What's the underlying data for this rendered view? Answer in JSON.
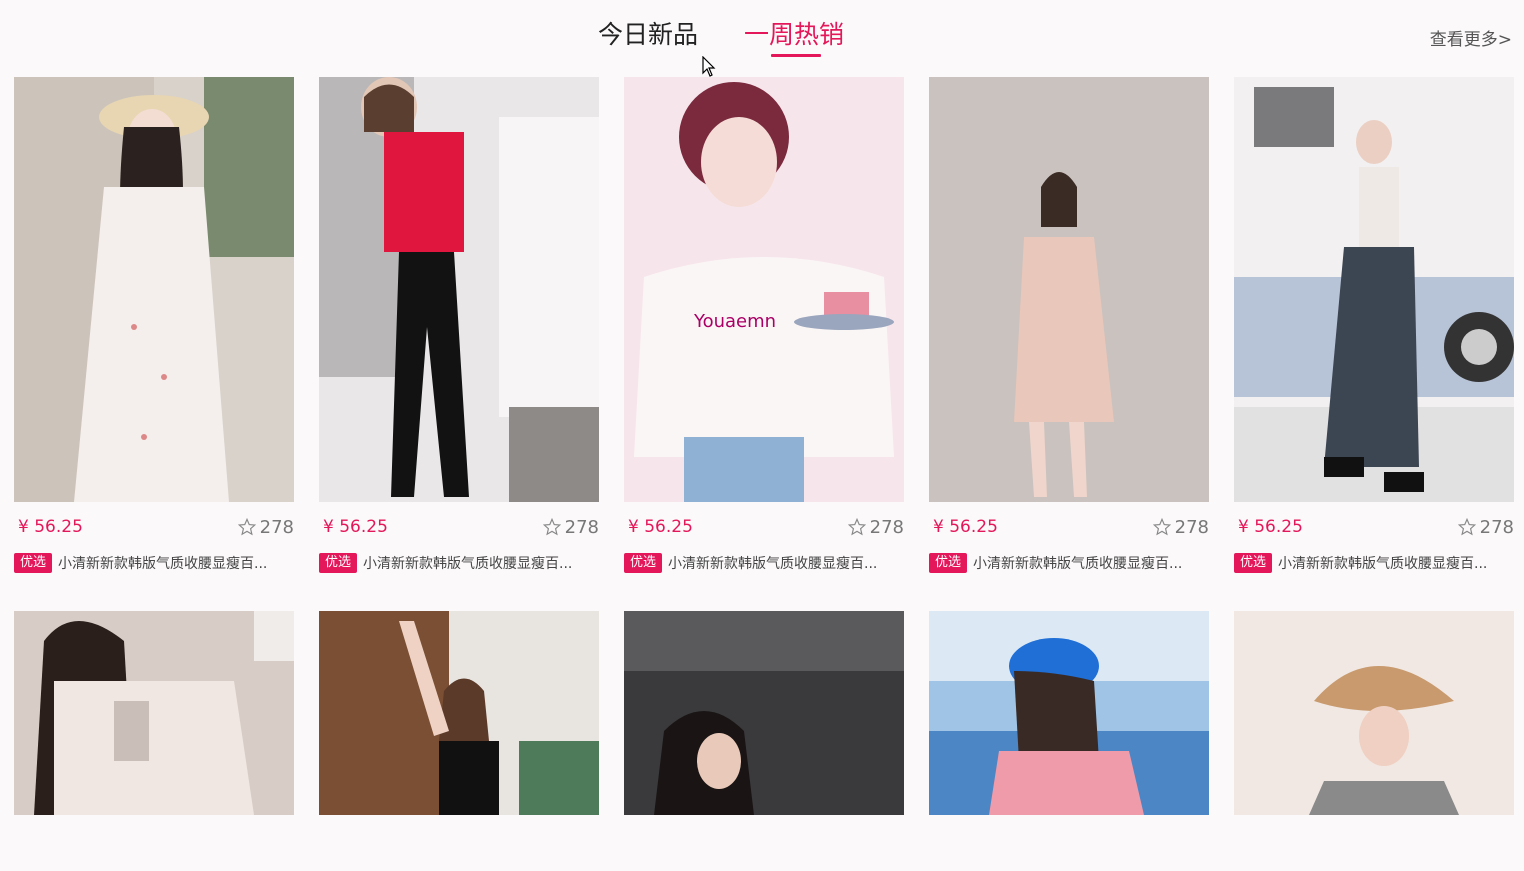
{
  "tabs": {
    "new_label": "今日新品",
    "hot_label": "一周热销"
  },
  "more_label": "查看更多>",
  "products": [
    {
      "price": "¥ 56.25",
      "fav_count": "278",
      "badge": "优选",
      "title": "小清新新款韩版气质收腰显瘦百..."
    },
    {
      "price": "¥ 56.25",
      "fav_count": "278",
      "badge": "优选",
      "title": "小清新新款韩版气质收腰显瘦百..."
    },
    {
      "price": "¥ 56.25",
      "fav_count": "278",
      "badge": "优选",
      "title": "小清新新款韩版气质收腰显瘦百..."
    },
    {
      "price": "¥ 56.25",
      "fav_count": "278",
      "badge": "优选",
      "title": "小清新新款韩版气质收腰显瘦百..."
    },
    {
      "price": "¥ 56.25",
      "fav_count": "278",
      "badge": "优选",
      "title": "小清新新款韩版气质收腰显瘦百..."
    }
  ],
  "colors": {
    "accent": "#e4175b",
    "background": "#fbf9f9"
  }
}
